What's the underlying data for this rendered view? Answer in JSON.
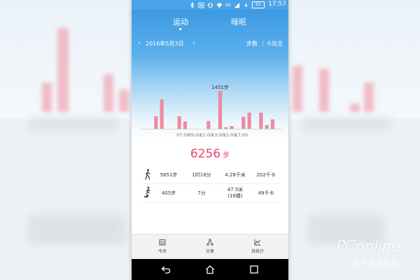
{
  "status_bar": {
    "time": "17:57",
    "battery": "92",
    "network": "4G"
  },
  "tabs": [
    {
      "label": "运动",
      "active": true
    },
    {
      "label": "睡眠",
      "active": false
    }
  ],
  "date_nav": {
    "prev": "‹",
    "date": "2016年5月3日",
    "next": "›"
  },
  "unit_toggle": {
    "steps": "步数",
    "separator": "|",
    "calories": "卡路里"
  },
  "chart_data": {
    "type": "bar",
    "x_ticks": [
      "07:00",
      "09:00",
      "11:00",
      "13:00",
      "15:00",
      "17:00"
    ],
    "slot_count": 24,
    "series": [
      {
        "color": "#ee8aa0",
        "values": [
          0,
          0,
          480,
          1120,
          0,
          0,
          480,
          280,
          0,
          0,
          0,
          300,
          0,
          1451,
          60,
          100,
          0,
          460,
          620,
          0,
          620,
          140,
          360,
          0
        ]
      }
    ],
    "peak_label": "1451步",
    "peak_index": 13,
    "ymax": 1500
  },
  "total": {
    "value": "6256",
    "unit": "步"
  },
  "stats": [
    {
      "icon": "walking-icon",
      "steps": "5851步",
      "time": "1时18分",
      "distance": "4.28千米",
      "distance_sub": "",
      "calories": "202千卡"
    },
    {
      "icon": "stairs-climbing-icon",
      "steps": "405步",
      "time": "7分",
      "distance": "47.5米",
      "distance_sub": "(16楼)",
      "calories": "49千卡"
    }
  ],
  "bottom_nav": [
    {
      "icon": "calendar-icon",
      "label": "今天"
    },
    {
      "icon": "share-icon",
      "label": "分享"
    },
    {
      "icon": "chart-icon",
      "label": "月统计"
    }
  ],
  "watermark": {
    "text": "PConline",
    "subtext": "太平洋电脑网"
  },
  "colors": {
    "header": "#3c9ae2",
    "accent": "#e8426a",
    "bar": "#ee8aa0"
  }
}
